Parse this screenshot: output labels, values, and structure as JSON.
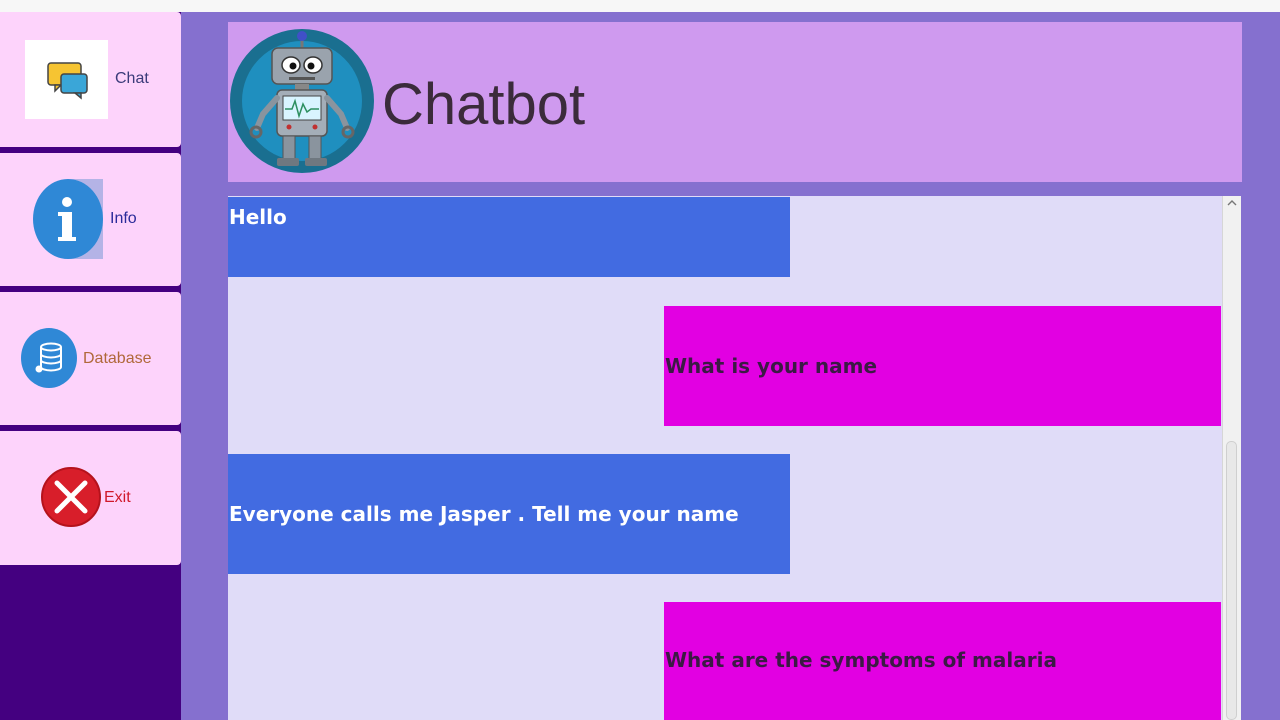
{
  "sidebar": {
    "items": [
      {
        "label": "Chat",
        "icon": "chat-bubbles-icon"
      },
      {
        "label": "Info",
        "icon": "info-icon"
      },
      {
        "label": "Database",
        "icon": "database-icon"
      },
      {
        "label": "Exit",
        "icon": "close-icon"
      }
    ]
  },
  "header": {
    "title": "Chatbot",
    "logo": "robot-icon"
  },
  "chat": {
    "messages": [
      {
        "sender": "bot",
        "text": "Hello"
      },
      {
        "sender": "user",
        "text": "What is your name"
      },
      {
        "sender": "bot",
        "text": "Everyone calls me Jasper . Tell me your name"
      },
      {
        "sender": "user",
        "text": "What are the symptoms of malaria"
      }
    ]
  },
  "colors": {
    "sidebar_bg": "#440080",
    "nav_button_bg": "#fdd3fb",
    "main_bg": "#8570cf",
    "header_bg": "#cf9aef",
    "chat_bg": "#e0dcf8",
    "bot_bubble": "#426be1",
    "user_bubble": "#e200e2"
  }
}
